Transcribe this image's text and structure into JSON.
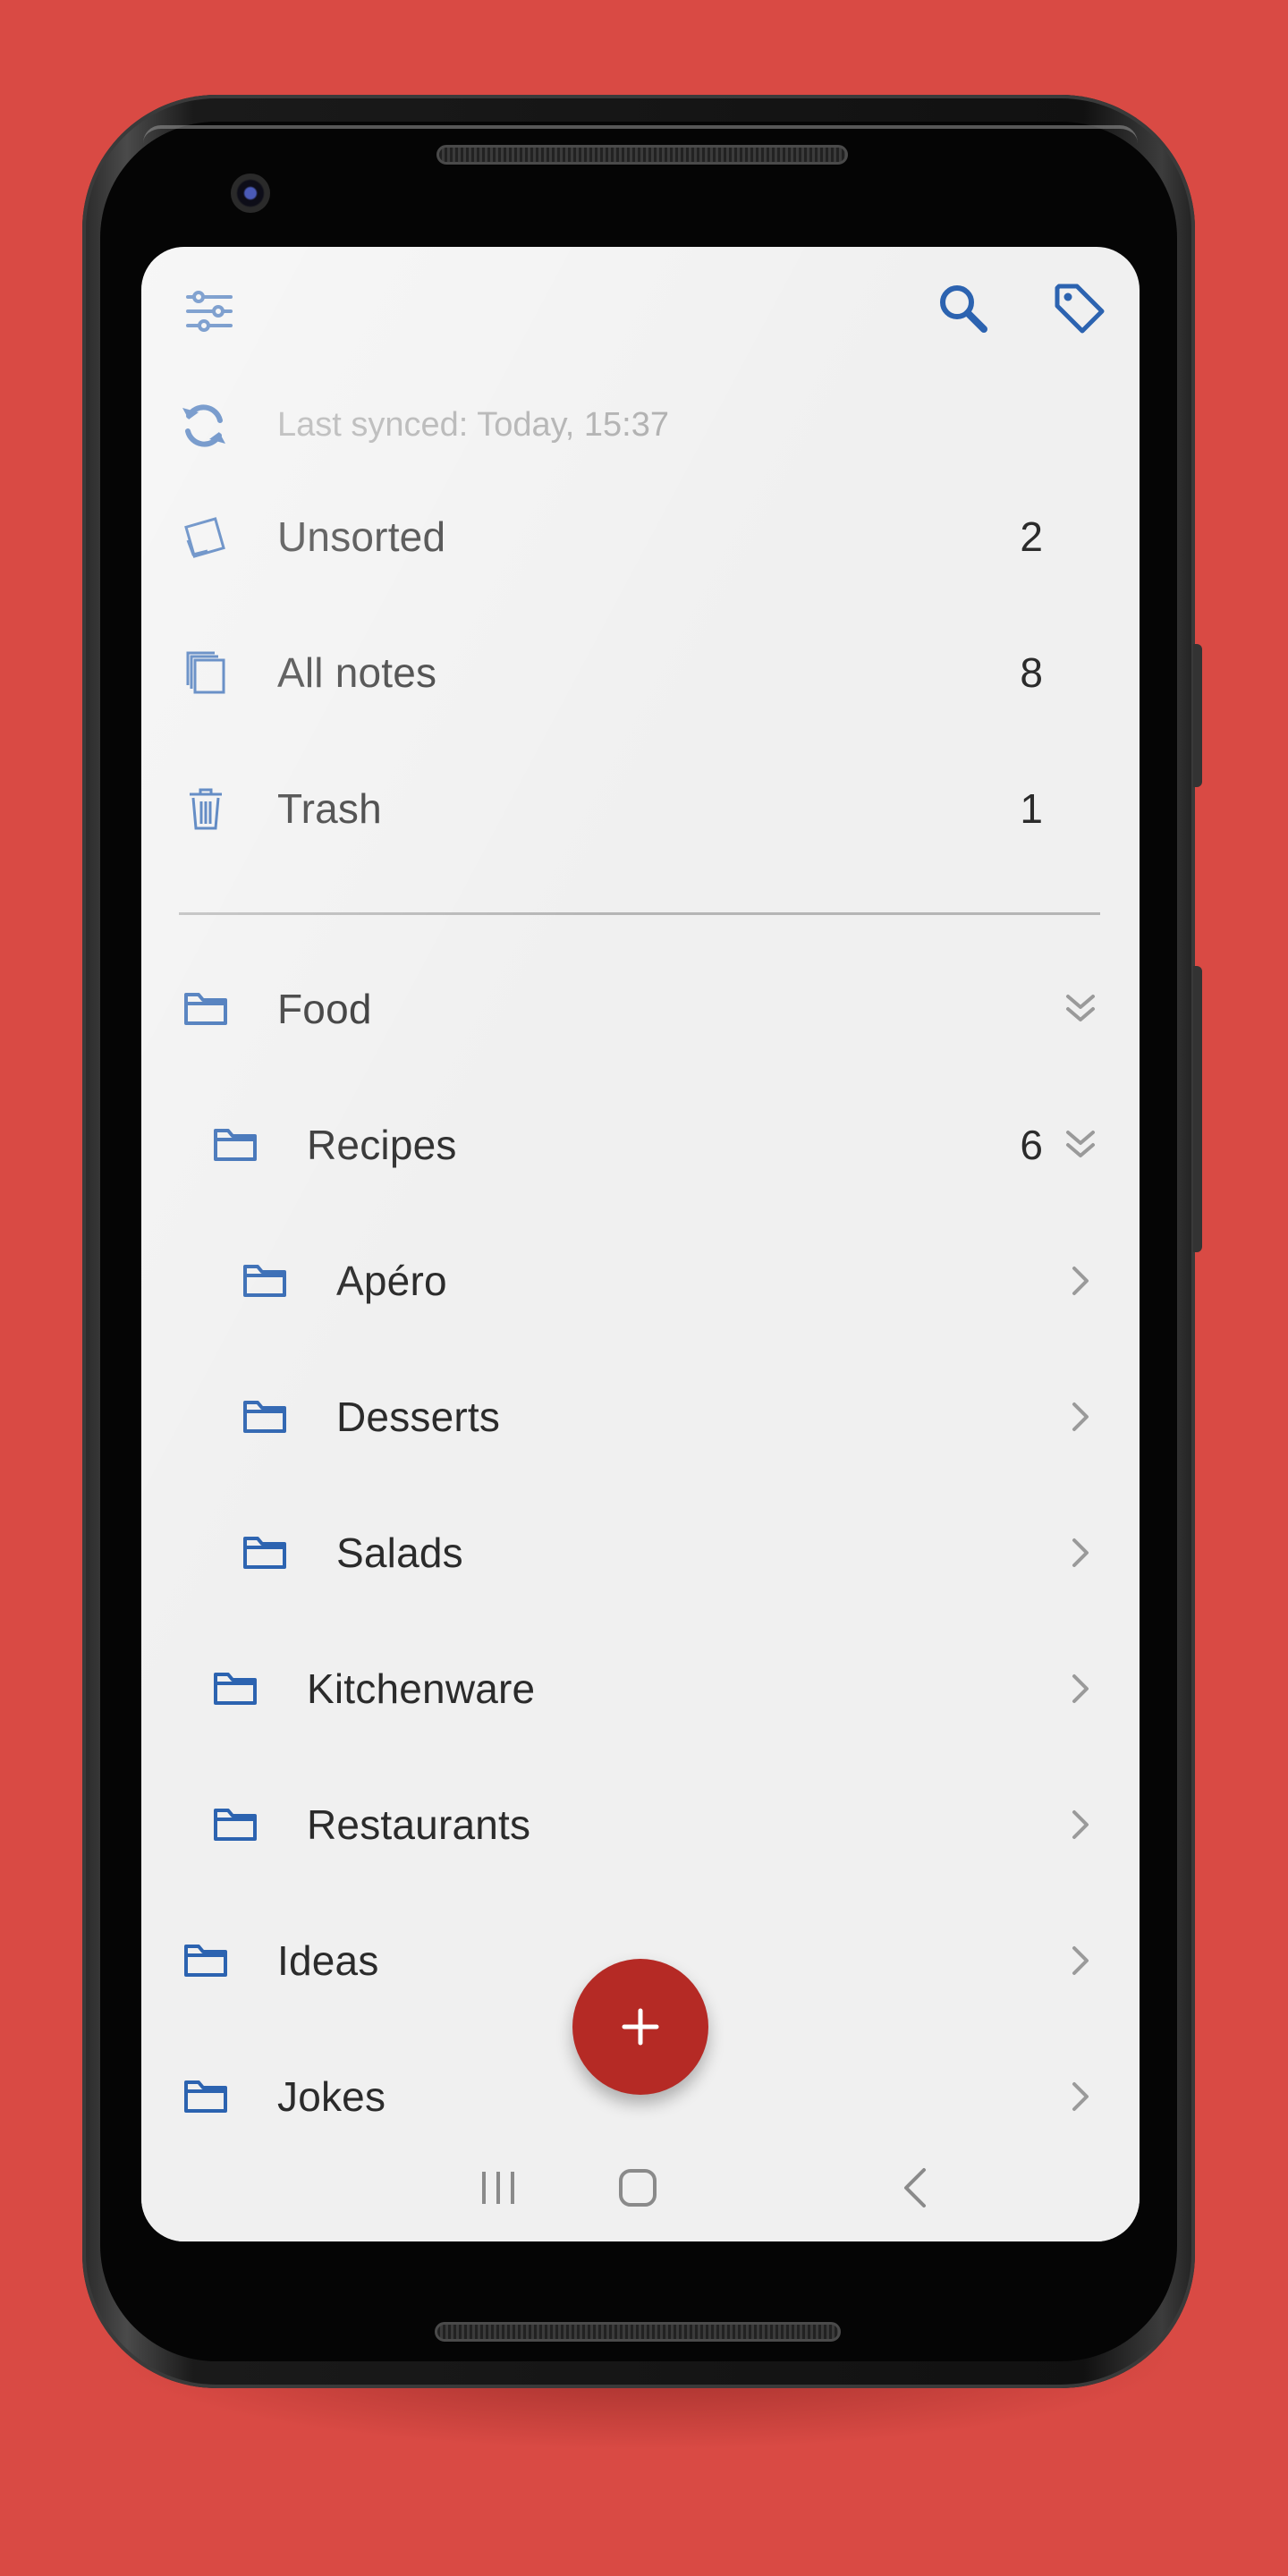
{
  "app": {
    "accent_color": "#2c63b0",
    "fab_color": "#b52a25",
    "background_color": "#d94a44"
  },
  "toolbar": {
    "left_icon": "sliders-icon",
    "search_icon": "search-icon",
    "tag_icon": "tag-icon"
  },
  "sync": {
    "icon": "sync-icon",
    "text": "Last synced: Today, 15:37"
  },
  "special_folders": [
    {
      "label": "Unsorted",
      "count": "2",
      "icon": "unsorted-icon"
    },
    {
      "label": "All notes",
      "count": "8",
      "icon": "all-notes-icon"
    },
    {
      "label": "Trash",
      "count": "1",
      "icon": "trash-icon"
    }
  ],
  "folders": [
    {
      "label": "Food",
      "count": "",
      "level": 0,
      "state": "expanded"
    },
    {
      "label": "Recipes",
      "count": "6",
      "level": 1,
      "state": "expanded"
    },
    {
      "label": "Apéro",
      "count": "",
      "level": 2,
      "state": "collapsed"
    },
    {
      "label": "Desserts",
      "count": "",
      "level": 2,
      "state": "collapsed"
    },
    {
      "label": "Salads",
      "count": "",
      "level": 2,
      "state": "collapsed"
    },
    {
      "label": "Kitchenware",
      "count": "",
      "level": 1,
      "state": "collapsed"
    },
    {
      "label": "Restaurants",
      "count": "",
      "level": 1,
      "state": "collapsed"
    },
    {
      "label": "Ideas",
      "count": "",
      "level": 0,
      "state": "collapsed"
    },
    {
      "label": "Jokes",
      "count": "",
      "level": 0,
      "state": "collapsed"
    }
  ],
  "fab": {
    "label": "+"
  },
  "navbar": {
    "recents_icon": "recents-icon",
    "home_icon": "home-icon",
    "back_icon": "back-icon"
  }
}
